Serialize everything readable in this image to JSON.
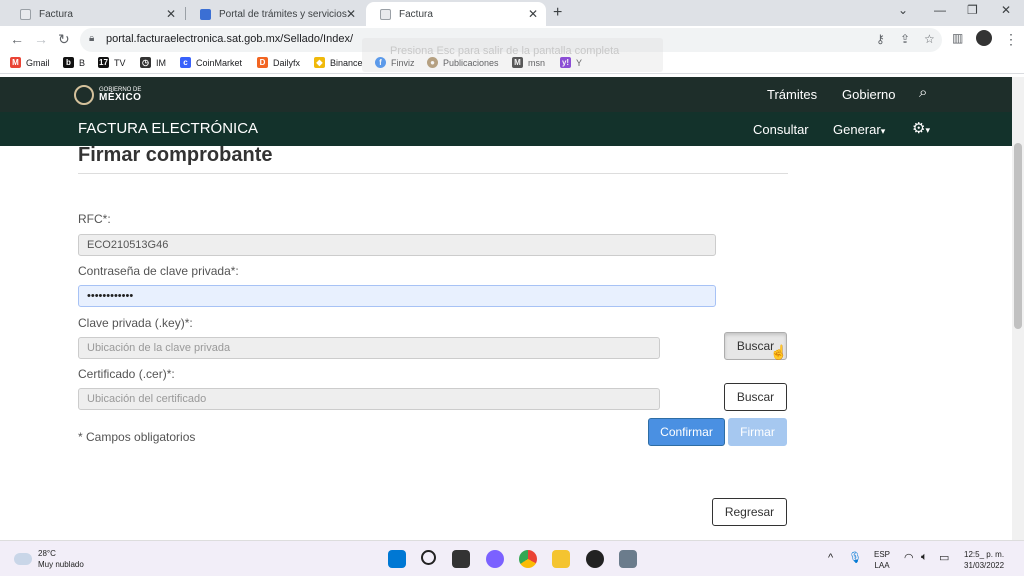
{
  "browser": {
    "tabs": [
      {
        "title": "Factura"
      },
      {
        "title": "Portal de trámites y servicios - SAT"
      },
      {
        "title": "Factura"
      }
    ],
    "new_tab": "+",
    "url": "portal.facturaelectronica.sat.gob.mx/Sellado/Index/",
    "fullscreen_notice": "Presiona  Esc  para salir de la pantalla completa",
    "bookmarks": [
      {
        "label": "Gmail"
      },
      {
        "label": "B"
      },
      {
        "label": "TV"
      },
      {
        "label": "IM"
      },
      {
        "label": "CoinMarket"
      },
      {
        "label": "Dailyfx"
      },
      {
        "label": "Binance"
      },
      {
        "label": "Finviz"
      },
      {
        "label": "Publicaciones"
      },
      {
        "label": "msn"
      },
      {
        "label": "Y"
      }
    ]
  },
  "site": {
    "logo_top": "GOBIERNO DE",
    "logo_main": "MÉXICO",
    "nav_tramites": "Trámites",
    "nav_gobierno": "Gobierno",
    "brand": "FACTURA ELECTRÓNICA",
    "nav_consultar": "Consultar",
    "nav_generar": "Generar",
    "caret": "▾"
  },
  "form": {
    "title": "Firmar comprobante",
    "rfc_label": "RFC*:",
    "rfc_value": "ECO210513G46",
    "password_label": "Contraseña de clave privada*:",
    "password_value": "••••••••••••",
    "key_label": "Clave privada (.key)*:",
    "key_placeholder": "Ubicación de la clave privada",
    "cert_label": "Certificado (.cer)*:",
    "cert_placeholder": "Ubicación del certificado",
    "browse_label": "Buscar",
    "required_note": "* Campos obligatorios",
    "confirm_label": "Confirmar",
    "sign_label": "Firmar",
    "back_label": "Regresar"
  },
  "taskbar": {
    "temp": "28°C",
    "weather": "Muy nublado",
    "lang1": "ESP",
    "lang2": "LAA",
    "time": "12:5_ p. m.",
    "date": "31/03/2022"
  },
  "colors": {
    "header_dark": "#1e2e2a",
    "header_green": "#13322b",
    "primary": "#4a90e2"
  }
}
